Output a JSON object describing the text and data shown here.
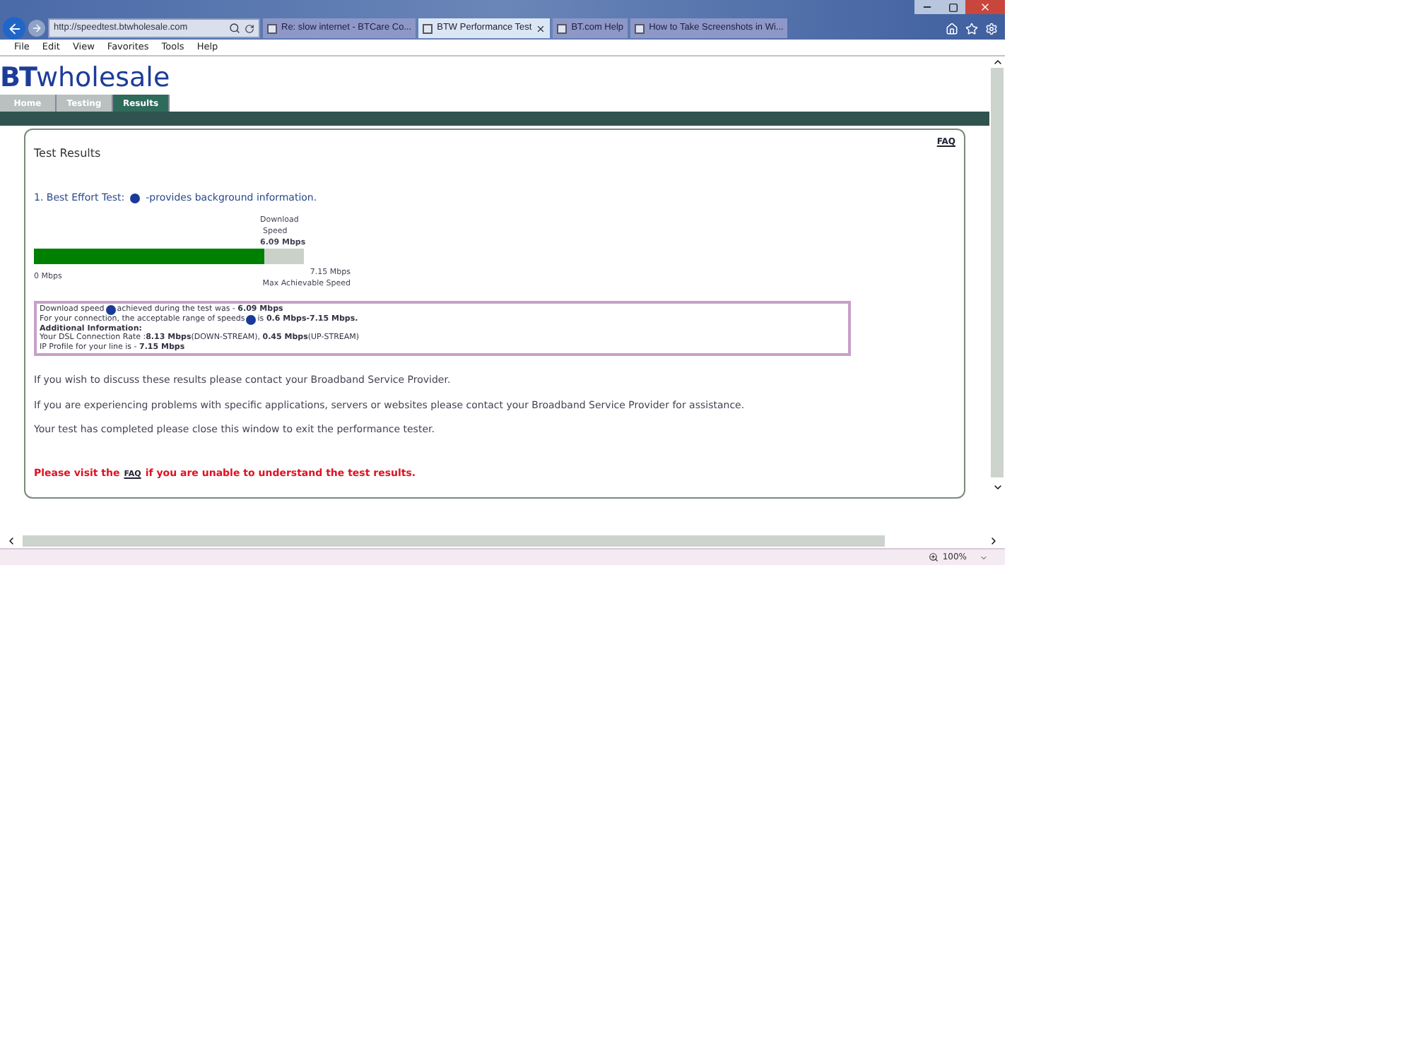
{
  "browser": {
    "address": "http://speedtest.btwholesale.com",
    "tabs": [
      {
        "label": "Re: slow internet - BTCare Co...",
        "selected": false
      },
      {
        "label": "BTW Performance Test",
        "selected": true
      },
      {
        "label": "BT.com Help",
        "selected": false
      },
      {
        "label": "How to Take Screenshots in Wi...",
        "selected": false
      }
    ],
    "menu": [
      "File",
      "Edit",
      "View",
      "Favorites",
      "Tools",
      "Help"
    ],
    "zoom": "100%"
  },
  "site": {
    "logo_bold": "BT",
    "logo_text": "wholesale",
    "nav": [
      {
        "label": "Home",
        "selected": false
      },
      {
        "label": "Testing",
        "selected": false
      },
      {
        "label": "Results",
        "selected": true
      }
    ]
  },
  "results": {
    "title": "Test Results",
    "faq_link": "FAQ",
    "test_heading_before": "1. Best Effort Test:",
    "test_heading_after": "-provides background information.",
    "gauge": {
      "label_top": "Download",
      "label_mid": "Speed",
      "value": "6.09 Mbps",
      "level": 0.852,
      "min": "0 Mbps",
      "max": "7.15 Mbps",
      "max_label": "Max Achievable Speed"
    },
    "info_lines": [
      {
        "before": "Download speed",
        "help": true,
        "after": "achieved during the test was - **6.09 Mbps**"
      },
      {
        "before": "For your connection, the acceptable range of speeds",
        "help": true,
        "after": " is **0.6 Mbps-7.15 Mbps.**"
      },
      {
        "before": "**Additional Information:**",
        "help": false
      },
      {
        "before": "Your DSL Connection Rate :**8.13 Mbps**(DOWN-STREAM), **0.45 Mbps**(UP-STREAM)",
        "help": false
      },
      {
        "before": "IP Profile for your line is - **7.15 Mbps**",
        "help": false
      }
    ],
    "paragraphs": [
      "If you wish to discuss these results please contact your Broadband Service Provider.",
      "If you are experiencing problems with specific applications, servers or websites please contact your Broadband Service Provider for assistance.",
      "Your test has completed please close this window to exit the performance tester."
    ],
    "notice_before": "Please visit the",
    "notice_link": "FAQ",
    "notice_after": "if you are unable to understand the test results."
  }
}
